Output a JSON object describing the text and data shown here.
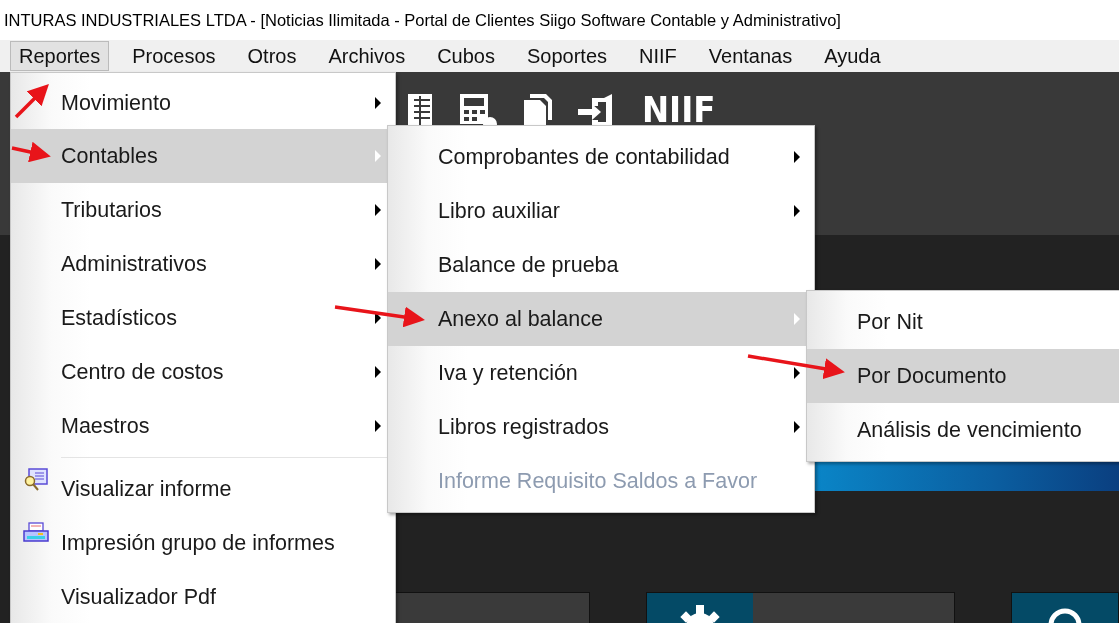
{
  "window": {
    "title": "INTURAS INDUSTRIALES LTDA - [Noticias Ilimitada - Portal de Clientes Siigo Software Contable y Administrativo]"
  },
  "menu_bar": [
    {
      "label": "Reportes",
      "selected": true
    },
    {
      "label": "Procesos",
      "selected": false
    },
    {
      "label": "Otros",
      "selected": false
    },
    {
      "label": "Archivos",
      "selected": false
    },
    {
      "label": "Cubos",
      "selected": false
    },
    {
      "label": "Soportes",
      "selected": false
    },
    {
      "label": "NIIF",
      "selected": false
    },
    {
      "label": "Ventanas",
      "selected": false
    },
    {
      "label": "Ayuda",
      "selected": false
    }
  ],
  "toolbar": {
    "label": "NIIF"
  },
  "menus": [
    {
      "items": [
        {
          "kind": "submenu",
          "label": "Movimiento",
          "selected": false
        },
        {
          "kind": "submenu",
          "label": "Contables",
          "selected": true
        },
        {
          "kind": "submenu",
          "label": "Tributarios",
          "selected": false
        },
        {
          "kind": "submenu",
          "label": "Administrativos",
          "selected": false
        },
        {
          "kind": "submenu",
          "label": "Estadísticos",
          "selected": false
        },
        {
          "kind": "submenu",
          "label": "Centro de costos",
          "selected": false
        },
        {
          "kind": "submenu",
          "label": "Maestros",
          "selected": false
        },
        {
          "kind": "separator"
        },
        {
          "kind": "viewer",
          "label": "Visualizar informe",
          "selected": false
        },
        {
          "kind": "printer",
          "label": "Impresión grupo de informes",
          "selected": false
        },
        {
          "kind": "command",
          "label": "Visualizador Pdf",
          "selected": false
        }
      ]
    },
    {
      "items": [
        {
          "kind": "submenu",
          "label": "Comprobantes de contabilidad",
          "selected": false,
          "disabled": false
        },
        {
          "kind": "submenu",
          "label": "Libro auxiliar",
          "selected": false,
          "disabled": false
        },
        {
          "kind": "command",
          "label": "Balance de prueba",
          "selected": false,
          "disabled": false
        },
        {
          "kind": "submenu",
          "label": "Anexo al balance",
          "selected": true,
          "disabled": false
        },
        {
          "kind": "submenu",
          "label": "Iva y retención",
          "selected": false,
          "disabled": false
        },
        {
          "kind": "submenu",
          "label": "Libros registrados",
          "selected": false,
          "disabled": false
        },
        {
          "kind": "command",
          "label": "Informe Requisito Saldos a Favor",
          "selected": false,
          "disabled": true
        }
      ]
    },
    {
      "items": [
        {
          "kind": "command",
          "label": "Por Nit",
          "selected": false
        },
        {
          "kind": "command",
          "label": "Por Documento",
          "selected": true
        },
        {
          "kind": "command",
          "label": "Análisis de vencimiento",
          "selected": false
        }
      ]
    }
  ]
}
